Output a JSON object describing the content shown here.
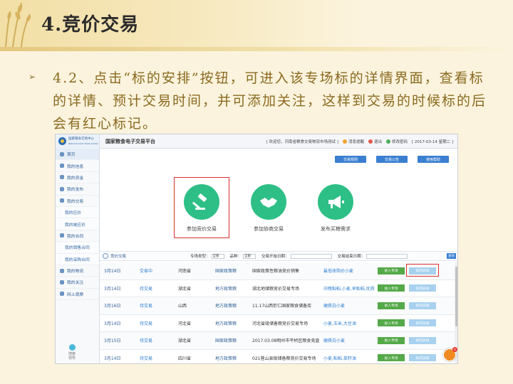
{
  "slide": {
    "title": "4.竞价交易",
    "bullet_glyph": "➢",
    "text": "4.2、点击“标的安排”按钮，可进入该专场标的详情界面，查看标的详情、预计交易时间，并可添加关注，这样到交易的时候标的后会有红心标记。"
  },
  "app": {
    "logo_line1": "国家粮食交易中心",
    "logo_line2": "National Grain Trade Center",
    "platform_title": "国家粮食电子交易平台",
    "welcome": "[ 欢迎您，河南省粮食交易物流市场测试 ]",
    "messages": "消息提醒",
    "logout": "退出",
    "change_password": "修改密码",
    "date": "[ 2017-03-14 星期二 ]"
  },
  "sidebar": {
    "items": [
      {
        "label": "首页",
        "sub": false
      },
      {
        "label": "我的信息",
        "sub": false
      },
      {
        "label": "我的资金",
        "sub": false
      },
      {
        "label": "我的发布",
        "sub": false
      },
      {
        "label": "我的交易",
        "sub": false
      },
      {
        "label": "我的应价",
        "sub": true
      },
      {
        "label": "我的被应价",
        "sub": true
      },
      {
        "label": "我的合同",
        "sub": false
      },
      {
        "label": "我的销售合同",
        "sub": true
      },
      {
        "label": "我的采购合同",
        "sub": true
      },
      {
        "label": "我的物流",
        "sub": false
      },
      {
        "label": "我的关注",
        "sub": false
      },
      {
        "label": "网上观摩",
        "sub": false
      }
    ],
    "bottom_label": "搜索领导"
  },
  "top_buttons": [
    "交易规则",
    "交易公告",
    "使用帮助"
  ],
  "big_actions": [
    {
      "label": "参加竞价交易",
      "icon": "gavel-icon"
    },
    {
      "label": "参加协商交易",
      "icon": "handshake-icon"
    },
    {
      "label": "发布买粮需求",
      "icon": "megaphone-icon"
    }
  ],
  "search": {
    "tab": "竞价交易",
    "type_label": "专场类型：",
    "type_value": "全部",
    "variety_label": "品种：",
    "variety_value": "全部",
    "start_label": "交易开始日期：",
    "end_label": "交易结束日期：",
    "query": "查询"
  },
  "rows": [
    {
      "date": "3月14日",
      "status": "交易中",
      "prov": "河南省",
      "type": "国家政策粮",
      "name": "国家政策性粮油竞价销售",
      "goods": "最低收购价小麦",
      "enter": "进入专场",
      "arrange": "标的安排",
      "highlight": true
    },
    {
      "date": "3月14日",
      "status": "待交易",
      "prov": "湖北省",
      "type": "地方政策粮",
      "name": "湖北地储粮竞价交易专场",
      "goods": "中晚籼稻,小麦,早籼稻,优质",
      "enter": "进入专场",
      "arrange": "标的安排",
      "highlight": false
    },
    {
      "date": "3月16日",
      "status": "待交易",
      "prov": "山西",
      "type": "地方政策粮",
      "name": "11.17山西忻仁国家粮食储备库",
      "goods": "硬质白小麦",
      "enter": "进入专场",
      "arrange": "标的安排",
      "highlight": false
    },
    {
      "date": "3月14日",
      "status": "待交易",
      "prov": "河北省",
      "type": "地方政策粮",
      "name": "河北省级储备粮竞价交易专场",
      "goods": "小麦,玉米,大豆油",
      "enter": "进入专场",
      "arrange": "标的安排",
      "highlight": false
    },
    {
      "date": "3月15日",
      "status": "待交易",
      "prov": "湖北省",
      "type": "国家政策粮",
      "name": "2017.03.08明州市平桥区粮食竞直",
      "goods": "硬质白小麦",
      "enter": "进入专场",
      "arrange": "标的安排",
      "highlight": false
    },
    {
      "date": "3月14日",
      "status": "待交易",
      "prov": "四川省",
      "type": "地方政策粮",
      "name": "021营山县级储备粮竞价交易专场",
      "goods": "小麦,籼稻,菜籽油",
      "enter": "进入专场",
      "arrange": "标的安排",
      "highlight": false
    }
  ],
  "floating_badge": "6",
  "colors": {
    "accent_green": "#2dbf86",
    "highlight_red": "#d9322d",
    "text_gold": "#8a6a20",
    "link_blue": "#2f5f95"
  }
}
